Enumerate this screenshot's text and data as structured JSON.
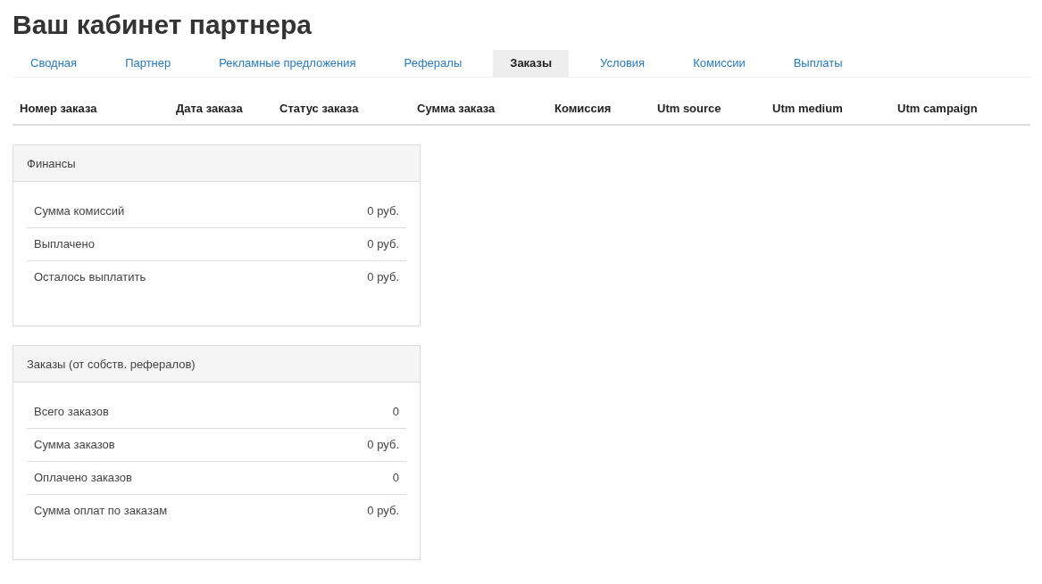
{
  "title": "Ваш кабинет партнера",
  "tabs": [
    {
      "label": "Сводная",
      "selected": false
    },
    {
      "label": "Партнер",
      "selected": false
    },
    {
      "label": "Рекламные предложения",
      "selected": false
    },
    {
      "label": "Рефералы",
      "selected": false
    },
    {
      "label": "Заказы",
      "selected": true
    },
    {
      "label": "Условия",
      "selected": false
    },
    {
      "label": "Комиссии",
      "selected": false
    },
    {
      "label": "Выплаты",
      "selected": false
    }
  ],
  "table": {
    "columns": [
      "Номер заказа",
      "Дата заказа",
      "Статус заказа",
      "Сумма заказа",
      "Комиссия",
      "Utm source",
      "Utm medium",
      "Utm campaign"
    ]
  },
  "panels": [
    {
      "title": "Финансы",
      "rows": [
        {
          "label": "Сумма комиссий",
          "value": "0 руб."
        },
        {
          "label": "Выплачено",
          "value": "0 руб."
        },
        {
          "label": "Осталось выплатить",
          "value": "0 руб."
        }
      ]
    },
    {
      "title": "Заказы (от собств. рефералов)",
      "rows": [
        {
          "label": "Всего заказов",
          "value": "0"
        },
        {
          "label": "Сумма заказов",
          "value": "0 руб."
        },
        {
          "label": "Оплачено заказов",
          "value": "0"
        },
        {
          "label": "Сумма оплат по заказам",
          "value": "0 руб."
        }
      ]
    }
  ]
}
